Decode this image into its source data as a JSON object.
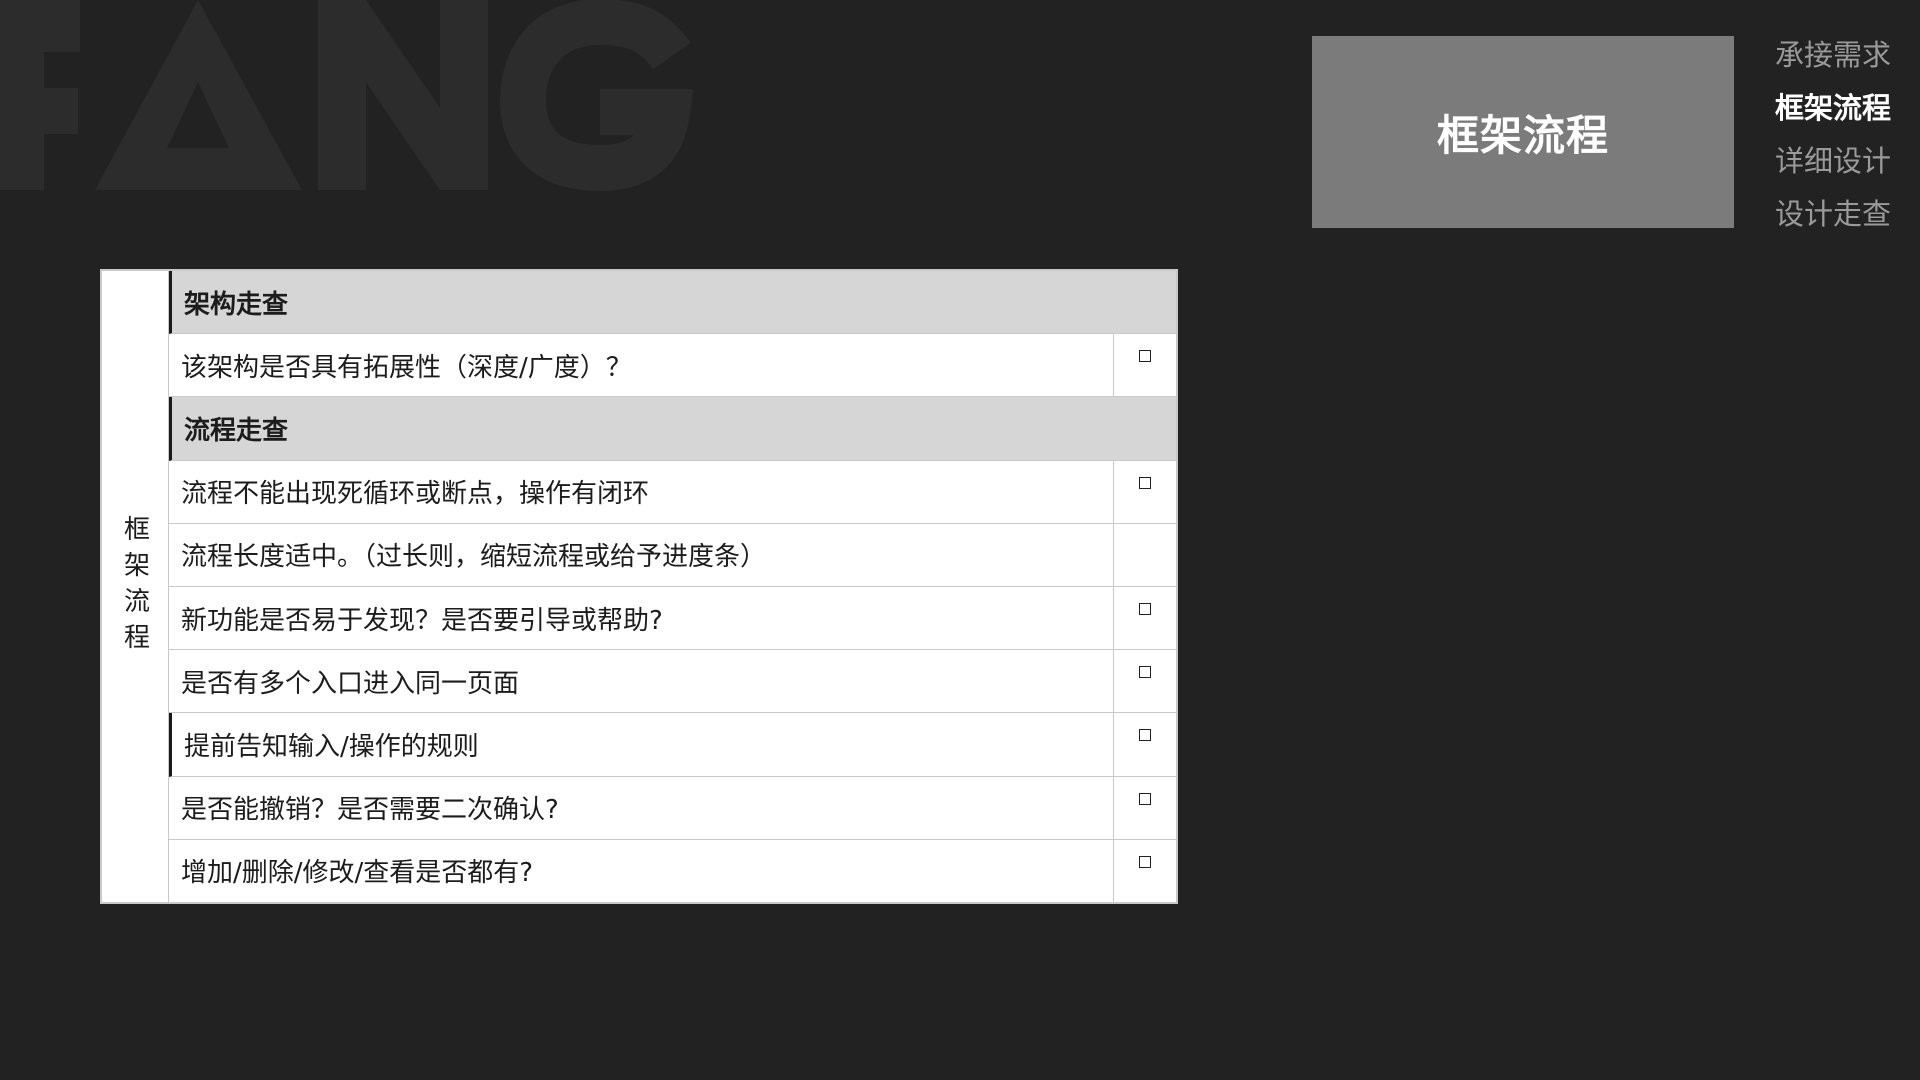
{
  "watermark": {
    "text": "FANG"
  },
  "current_section": {
    "title": "框架流程"
  },
  "nav": {
    "items": [
      {
        "label": "承接需求",
        "active": false
      },
      {
        "label": "框架流程",
        "active": true
      },
      {
        "label": "详细设计",
        "active": false
      },
      {
        "label": "设计走查",
        "active": false
      }
    ]
  },
  "checklist": {
    "group_label": "框架流程",
    "rows": [
      {
        "text": "架构走查",
        "type": "section",
        "checkbox": false
      },
      {
        "text": "该架构是否具有拓展性（深度/广度）？",
        "type": "item",
        "checkbox": true
      },
      {
        "text": "流程走查",
        "type": "section",
        "checkbox": false
      },
      {
        "text": "流程不能出现死循环或断点，操作有闭环",
        "type": "item",
        "checkbox": true
      },
      {
        "text": "流程长度适中。（过长则，缩短流程或给予进度条）",
        "type": "item",
        "checkbox": false
      },
      {
        "text": "新功能是否易于发现？是否要引导或帮助?",
        "type": "item",
        "checkbox": true
      },
      {
        "text": "是否有多个入口进入同一页面",
        "type": "item",
        "checkbox": true
      },
      {
        "text": "提前告知输入/操作的规则",
        "type": "item",
        "checkbox": true
      },
      {
        "text": "是否能撤销？是否需要二次确认?",
        "type": "item",
        "checkbox": true
      },
      {
        "text": "增加/删除/修改/查看是否都有?",
        "type": "item",
        "checkbox": true
      }
    ]
  },
  "colors": {
    "background": "#222222",
    "watermark": "#2c2c2c",
    "section_box": "#7b7b7b",
    "nav_inactive": "#9a9a9a",
    "nav_active": "#ffffff",
    "section_row": "#d6d6d6"
  }
}
